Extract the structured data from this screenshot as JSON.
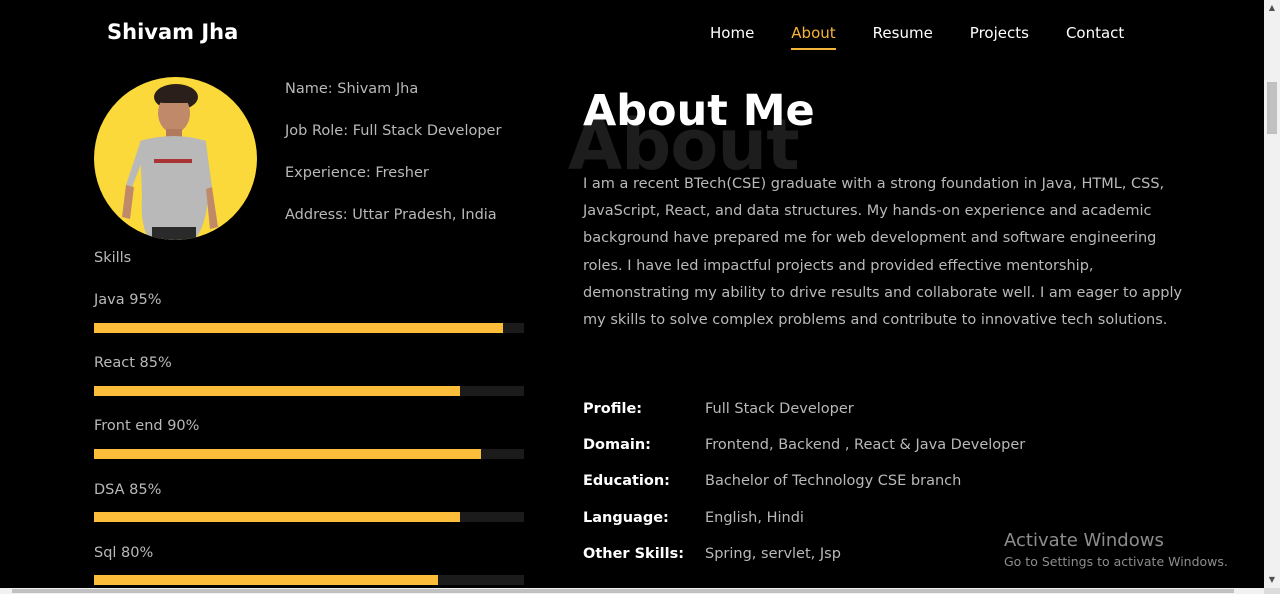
{
  "brand": "Shivam Jha",
  "nav": {
    "items": [
      "Home",
      "About",
      "Resume",
      "Projects",
      "Contact"
    ],
    "active": "About"
  },
  "profile": {
    "name": "Name: Shivam Jha",
    "role": "Job Role: Full Stack Developer",
    "experience": "Experience: Fresher",
    "address": "Address: Uttar Pradesh, India"
  },
  "skills": {
    "title": "Skills",
    "items": [
      {
        "label": "Java 95%",
        "percent": 95
      },
      {
        "label": "React 85%",
        "percent": 85
      },
      {
        "label": "Front end 90%",
        "percent": 90
      },
      {
        "label": "DSA 85%",
        "percent": 85
      },
      {
        "label": "Sql 80%",
        "percent": 80
      }
    ]
  },
  "about": {
    "background_word": "About",
    "title": "About Me",
    "text": "I am a recent BTech(CSE) graduate with a strong foundation in Java, HTML, CSS, JavaScript, React, and data structures. My hands-on experience and academic background have prepared me for web development and software engineering roles. I have led impactful projects and provided effective mentorship, demonstrating my ability to drive results and collaborate well. I am eager to apply my skills to solve complex problems and contribute to innovative tech solutions."
  },
  "details": [
    {
      "key": "Profile:",
      "value": "Full Stack Developer"
    },
    {
      "key": "Domain:",
      "value": "Frontend, Backend , React & Java Developer"
    },
    {
      "key": "Education:",
      "value": "Bachelor of Technology CSE branch"
    },
    {
      "key": "Language:",
      "value": "English, Hindi"
    },
    {
      "key": "Other Skills:",
      "value": "Spring, servlet, Jsp"
    }
  ],
  "watermark": {
    "title": "Activate Windows",
    "subtitle": "Go to Settings to activate Windows."
  },
  "colors": {
    "accent": "#f5b43a",
    "bar": "#fbbd3a",
    "avatar_bg": "#fbd93a",
    "background": "#000000"
  }
}
